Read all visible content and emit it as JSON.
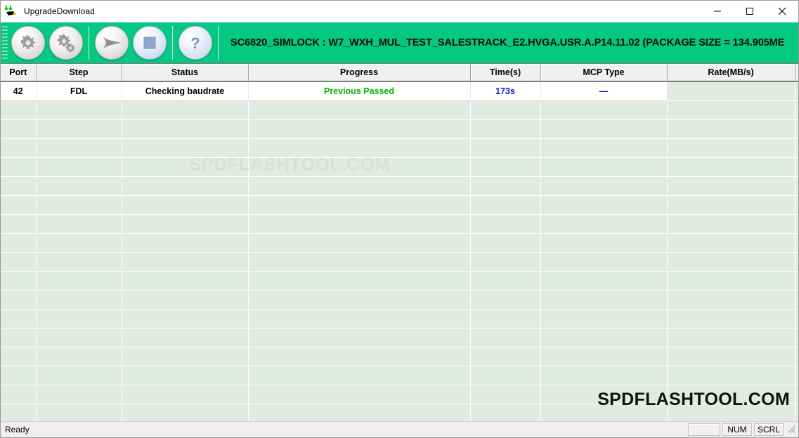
{
  "window": {
    "title": "UpgradeDownload",
    "icon": "download-chip-icon",
    "controls": {
      "minimize": "minimize-icon",
      "maximize": "maximize-icon",
      "close": "close-icon"
    }
  },
  "toolbar": {
    "accent_color": "#05c882",
    "buttons": [
      {
        "name": "settings-button",
        "icon": "gear-icon",
        "style": "grey"
      },
      {
        "name": "advanced-settings-button",
        "icon": "double-gear-icon",
        "style": "grey"
      },
      {
        "name": "start-download-button",
        "icon": "play-arrow-icon",
        "style": "grey"
      },
      {
        "name": "stop-download-button",
        "icon": "stop-square-icon",
        "style": "blue"
      },
      {
        "name": "help-button",
        "icon": "question-mark-icon",
        "style": "blue"
      }
    ],
    "title": "SC6820_SIMLOCK : W7_WXH_MUL_TEST_SALESTRACK_E2.HVGA.USR.A.P14.11.02 (PACKAGE SIZE = 134.905ME"
  },
  "grid": {
    "columns": [
      "Port",
      "Step",
      "Status",
      "Progress",
      "Time(s)",
      "MCP Type",
      "Rate(MB/s)"
    ],
    "rows": [
      {
        "port": "42",
        "step": "FDL",
        "status": "Checking baudrate",
        "progress": "Previous Passed",
        "time": "173s",
        "mcp_type": "—",
        "rate": ""
      }
    ],
    "colors": {
      "cell_background": "#e2ebe3",
      "progress_text": "#00b400",
      "time_text": "#1717d8",
      "mcp_text": "#1717d8"
    },
    "empty_row_count": 18
  },
  "watermarks": {
    "top": "SPDFLASHTOOL.COM",
    "bottom": "SPDFLASHTOOL.COM"
  },
  "statusbar": {
    "message": "Ready",
    "indicators": [
      "NUM",
      "SCRL"
    ]
  }
}
